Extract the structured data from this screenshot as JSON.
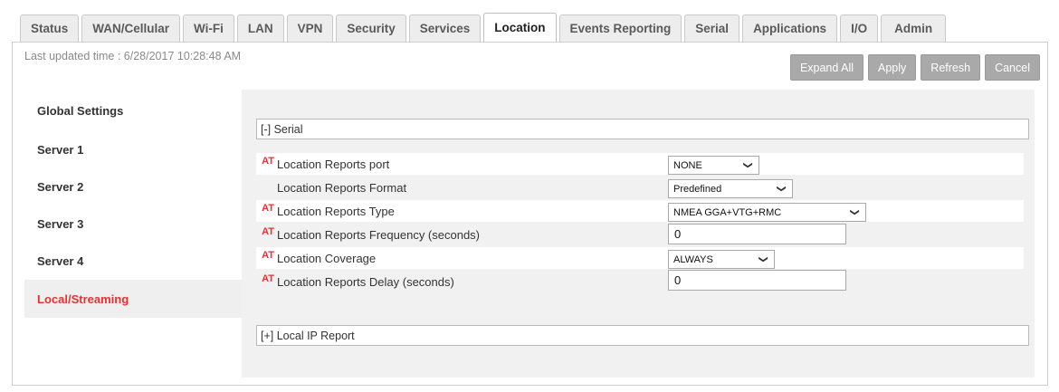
{
  "tabs": [
    {
      "label": "Status"
    },
    {
      "label": "WAN/Cellular"
    },
    {
      "label": "Wi-Fi"
    },
    {
      "label": "LAN"
    },
    {
      "label": "VPN"
    },
    {
      "label": "Security"
    },
    {
      "label": "Services"
    },
    {
      "label": "Location"
    },
    {
      "label": "Events Reporting"
    },
    {
      "label": "Serial"
    },
    {
      "label": "Applications"
    },
    {
      "label": "I/O"
    },
    {
      "label": "Admin"
    }
  ],
  "active_tab": "Location",
  "last_updated": "Last updated time : 6/28/2017 10:28:48 AM",
  "toolbar": {
    "expand_all": "Expand All",
    "apply": "Apply",
    "refresh": "Refresh",
    "cancel": "Cancel"
  },
  "sidebar": {
    "items": [
      {
        "label": "Global Settings"
      },
      {
        "label": "Server 1"
      },
      {
        "label": "Server 2"
      },
      {
        "label": "Server 3"
      },
      {
        "label": "Server 4"
      },
      {
        "label": "Local/Streaming"
      }
    ],
    "active": "Local/Streaming"
  },
  "sections": {
    "serial": "[-] Serial",
    "local_ip": "[+] Local IP Report"
  },
  "at_marker": "AT",
  "fields": [
    {
      "label": "Location Reports port",
      "value": "NONE"
    },
    {
      "label": "Location Reports Format",
      "value": "Predefined"
    },
    {
      "label": "Location Reports Type",
      "value": "NMEA GGA+VTG+RMC"
    },
    {
      "label": "Location Reports Frequency (seconds)",
      "value": "0"
    },
    {
      "label": "Location Coverage",
      "value": "ALWAYS"
    },
    {
      "label": "Location Reports Delay (seconds)",
      "value": "0"
    }
  ],
  "colors": {
    "accent_red": "#e53232",
    "button_gray": "#a9a9a9"
  }
}
